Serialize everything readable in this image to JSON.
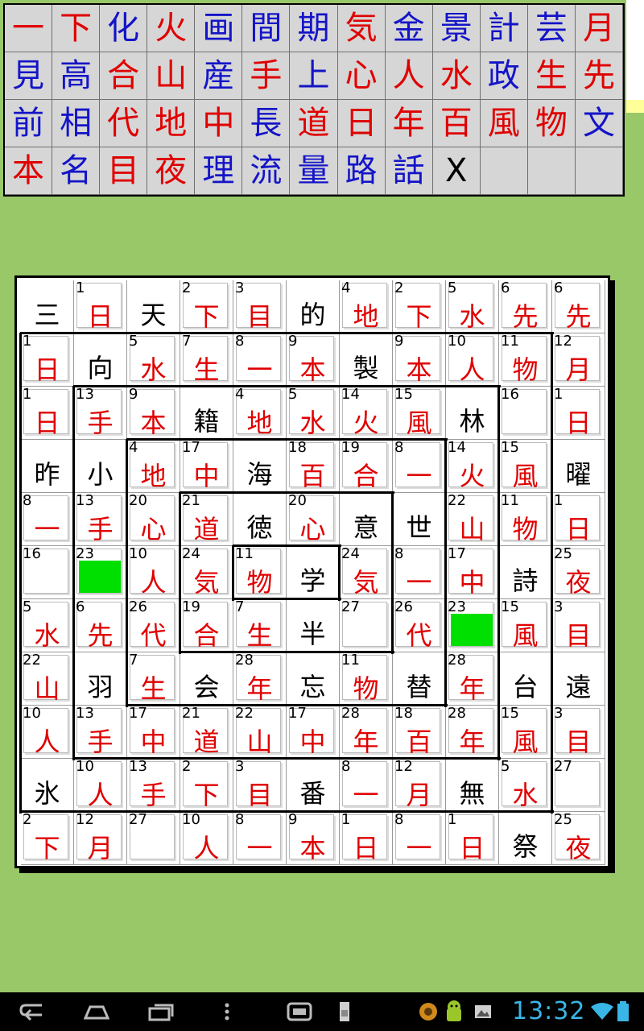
{
  "picker": {
    "cells": [
      {
        "k": "一",
        "c": "red"
      },
      {
        "k": "下",
        "c": "red"
      },
      {
        "k": "化",
        "c": "blue"
      },
      {
        "k": "火",
        "c": "red"
      },
      {
        "k": "画",
        "c": "blue"
      },
      {
        "k": "間",
        "c": "blue"
      },
      {
        "k": "期",
        "c": "blue"
      },
      {
        "k": "気",
        "c": "red"
      },
      {
        "k": "金",
        "c": "blue"
      },
      {
        "k": "景",
        "c": "blue"
      },
      {
        "k": "計",
        "c": "blue"
      },
      {
        "k": "芸",
        "c": "blue"
      },
      {
        "k": "月",
        "c": "red"
      },
      {
        "k": "見",
        "c": "blue"
      },
      {
        "k": "高",
        "c": "blue"
      },
      {
        "k": "合",
        "c": "red"
      },
      {
        "k": "山",
        "c": "red"
      },
      {
        "k": "産",
        "c": "blue"
      },
      {
        "k": "手",
        "c": "red"
      },
      {
        "k": "上",
        "c": "blue"
      },
      {
        "k": "心",
        "c": "red"
      },
      {
        "k": "人",
        "c": "red"
      },
      {
        "k": "水",
        "c": "red"
      },
      {
        "k": "政",
        "c": "blue"
      },
      {
        "k": "生",
        "c": "red"
      },
      {
        "k": "先",
        "c": "red"
      },
      {
        "k": "前",
        "c": "blue"
      },
      {
        "k": "相",
        "c": "blue"
      },
      {
        "k": "代",
        "c": "red"
      },
      {
        "k": "地",
        "c": "red"
      },
      {
        "k": "中",
        "c": "red"
      },
      {
        "k": "長",
        "c": "blue"
      },
      {
        "k": "道",
        "c": "red"
      },
      {
        "k": "日",
        "c": "red"
      },
      {
        "k": "年",
        "c": "red"
      },
      {
        "k": "百",
        "c": "red"
      },
      {
        "k": "風",
        "c": "red"
      },
      {
        "k": "物",
        "c": "red"
      },
      {
        "k": "文",
        "c": "blue"
      },
      {
        "k": "本",
        "c": "red"
      },
      {
        "k": "名",
        "c": "blue"
      },
      {
        "k": "目",
        "c": "red"
      },
      {
        "k": "夜",
        "c": "red"
      },
      {
        "k": "理",
        "c": "blue"
      },
      {
        "k": "流",
        "c": "blue"
      },
      {
        "k": "量",
        "c": "blue"
      },
      {
        "k": "路",
        "c": "blue"
      },
      {
        "k": "話",
        "c": "blue"
      },
      {
        "k": "X",
        "c": "black"
      },
      {
        "k": "",
        "c": "empty"
      },
      {
        "k": "",
        "c": "empty"
      },
      {
        "k": "",
        "c": "empty"
      }
    ]
  },
  "board": {
    "rows": [
      [
        {
          "f": "三"
        },
        {
          "n": "1",
          "k": "日"
        },
        {
          "f": "天"
        },
        {
          "n": "2",
          "k": "下"
        },
        {
          "n": "3",
          "k": "目"
        },
        {
          "f": "的"
        },
        {
          "n": "4",
          "k": "地"
        },
        {
          "n": "2",
          "k": "下"
        },
        {
          "n": "5",
          "k": "水"
        },
        {
          "n": "6",
          "k": "先"
        },
        {
          "n": "6",
          "k": "先"
        }
      ],
      [
        {
          "n": "1",
          "k": "日"
        },
        {
          "f": "向"
        },
        {
          "n": "5",
          "k": "水"
        },
        {
          "n": "7",
          "k": "生"
        },
        {
          "n": "8",
          "k": "一"
        },
        {
          "n": "9",
          "k": "本"
        },
        {
          "f": "製"
        },
        {
          "n": "9",
          "k": "本"
        },
        {
          "n": "10",
          "k": "人"
        },
        {
          "n": "11",
          "k": "物"
        },
        {
          "n": "12",
          "k": "月"
        }
      ],
      [
        {
          "n": "1",
          "k": "日"
        },
        {
          "n": "13",
          "k": "手"
        },
        {
          "n": "9",
          "k": "本"
        },
        {
          "f": "籍"
        },
        {
          "n": "4",
          "k": "地"
        },
        {
          "n": "5",
          "k": "水"
        },
        {
          "n": "14",
          "k": "火"
        },
        {
          "n": "15",
          "k": "風"
        },
        {
          "f": "林"
        },
        {
          "n": "16",
          "k": ""
        },
        {
          "n": "1",
          "k": "日"
        }
      ],
      [
        {
          "f": "昨"
        },
        {
          "f": "小"
        },
        {
          "n": "4",
          "k": "地"
        },
        {
          "n": "17",
          "k": "中"
        },
        {
          "f": "海"
        },
        {
          "n": "18",
          "k": "百"
        },
        {
          "n": "19",
          "k": "合"
        },
        {
          "n": "8",
          "k": "一"
        },
        {
          "n": "14",
          "k": "火"
        },
        {
          "n": "15",
          "k": "風"
        },
        {
          "f": "曜"
        }
      ],
      [
        {
          "n": "8",
          "k": "一"
        },
        {
          "n": "13",
          "k": "手"
        },
        {
          "n": "20",
          "k": "心"
        },
        {
          "n": "21",
          "k": "道"
        },
        {
          "f": "徳"
        },
        {
          "n": "20",
          "k": "心"
        },
        {
          "f": "意"
        },
        {
          "f": "世"
        },
        {
          "n": "22",
          "k": "山"
        },
        {
          "n": "11",
          "k": "物"
        },
        {
          "n": "1",
          "k": "日"
        }
      ],
      [
        {
          "n": "16",
          "k": ""
        },
        {
          "n": "23",
          "k": "",
          "g": true
        },
        {
          "n": "10",
          "k": "人"
        },
        {
          "n": "24",
          "k": "気"
        },
        {
          "n": "11",
          "k": "物"
        },
        {
          "f": "学"
        },
        {
          "n": "24",
          "k": "気"
        },
        {
          "n": "8",
          "k": "一"
        },
        {
          "n": "17",
          "k": "中"
        },
        {
          "f": "詩"
        },
        {
          "n": "25",
          "k": "夜"
        }
      ],
      [
        {
          "n": "5",
          "k": "水"
        },
        {
          "n": "6",
          "k": "先"
        },
        {
          "n": "26",
          "k": "代"
        },
        {
          "n": "19",
          "k": "合"
        },
        {
          "n": "7",
          "k": "生"
        },
        {
          "f": "半"
        },
        {
          "n": "27",
          "k": ""
        },
        {
          "n": "26",
          "k": "代"
        },
        {
          "n": "23",
          "k": "",
          "g": true
        },
        {
          "n": "15",
          "k": "風"
        },
        {
          "n": "3",
          "k": "目"
        }
      ],
      [
        {
          "n": "22",
          "k": "山"
        },
        {
          "f": "羽"
        },
        {
          "n": "7",
          "k": "生"
        },
        {
          "f": "会"
        },
        {
          "n": "28",
          "k": "年"
        },
        {
          "f": "忘"
        },
        {
          "n": "11",
          "k": "物"
        },
        {
          "f": "替"
        },
        {
          "n": "28",
          "k": "年"
        },
        {
          "f": "台"
        },
        {
          "f": "遠"
        }
      ],
      [
        {
          "n": "10",
          "k": "人"
        },
        {
          "n": "13",
          "k": "手"
        },
        {
          "n": "17",
          "k": "中"
        },
        {
          "n": "21",
          "k": "道"
        },
        {
          "n": "22",
          "k": "山"
        },
        {
          "n": "17",
          "k": "中"
        },
        {
          "n": "28",
          "k": "年"
        },
        {
          "n": "18",
          "k": "百"
        },
        {
          "n": "28",
          "k": "年"
        },
        {
          "n": "15",
          "k": "風"
        },
        {
          "n": "3",
          "k": "目"
        }
      ],
      [
        {
          "f": "氷"
        },
        {
          "n": "10",
          "k": "人"
        },
        {
          "n": "13",
          "k": "手"
        },
        {
          "n": "2",
          "k": "下"
        },
        {
          "n": "3",
          "k": "目"
        },
        {
          "f": "番"
        },
        {
          "n": "8",
          "k": "一"
        },
        {
          "n": "12",
          "k": "月"
        },
        {
          "f": "無"
        },
        {
          "n": "5",
          "k": "水"
        },
        {
          "n": "27",
          "k": ""
        }
      ],
      [
        {
          "n": "2",
          "k": "下"
        },
        {
          "n": "12",
          "k": "月"
        },
        {
          "n": "27",
          "k": ""
        },
        {
          "n": "10",
          "k": "人"
        },
        {
          "n": "8",
          "k": "一"
        },
        {
          "n": "9",
          "k": "本"
        },
        {
          "n": "1",
          "k": "日"
        },
        {
          "n": "8",
          "k": "一"
        },
        {
          "n": "1",
          "k": "日"
        },
        {
          "f": "祭"
        },
        {
          "n": "25",
          "k": "夜"
        }
      ]
    ]
  },
  "statusbar": {
    "clock": "13:32"
  },
  "nav": {
    "back_icon": "back-icon",
    "home_icon": "home-icon",
    "recents_icon": "recents-icon",
    "menu_icon": "menu-icon"
  }
}
